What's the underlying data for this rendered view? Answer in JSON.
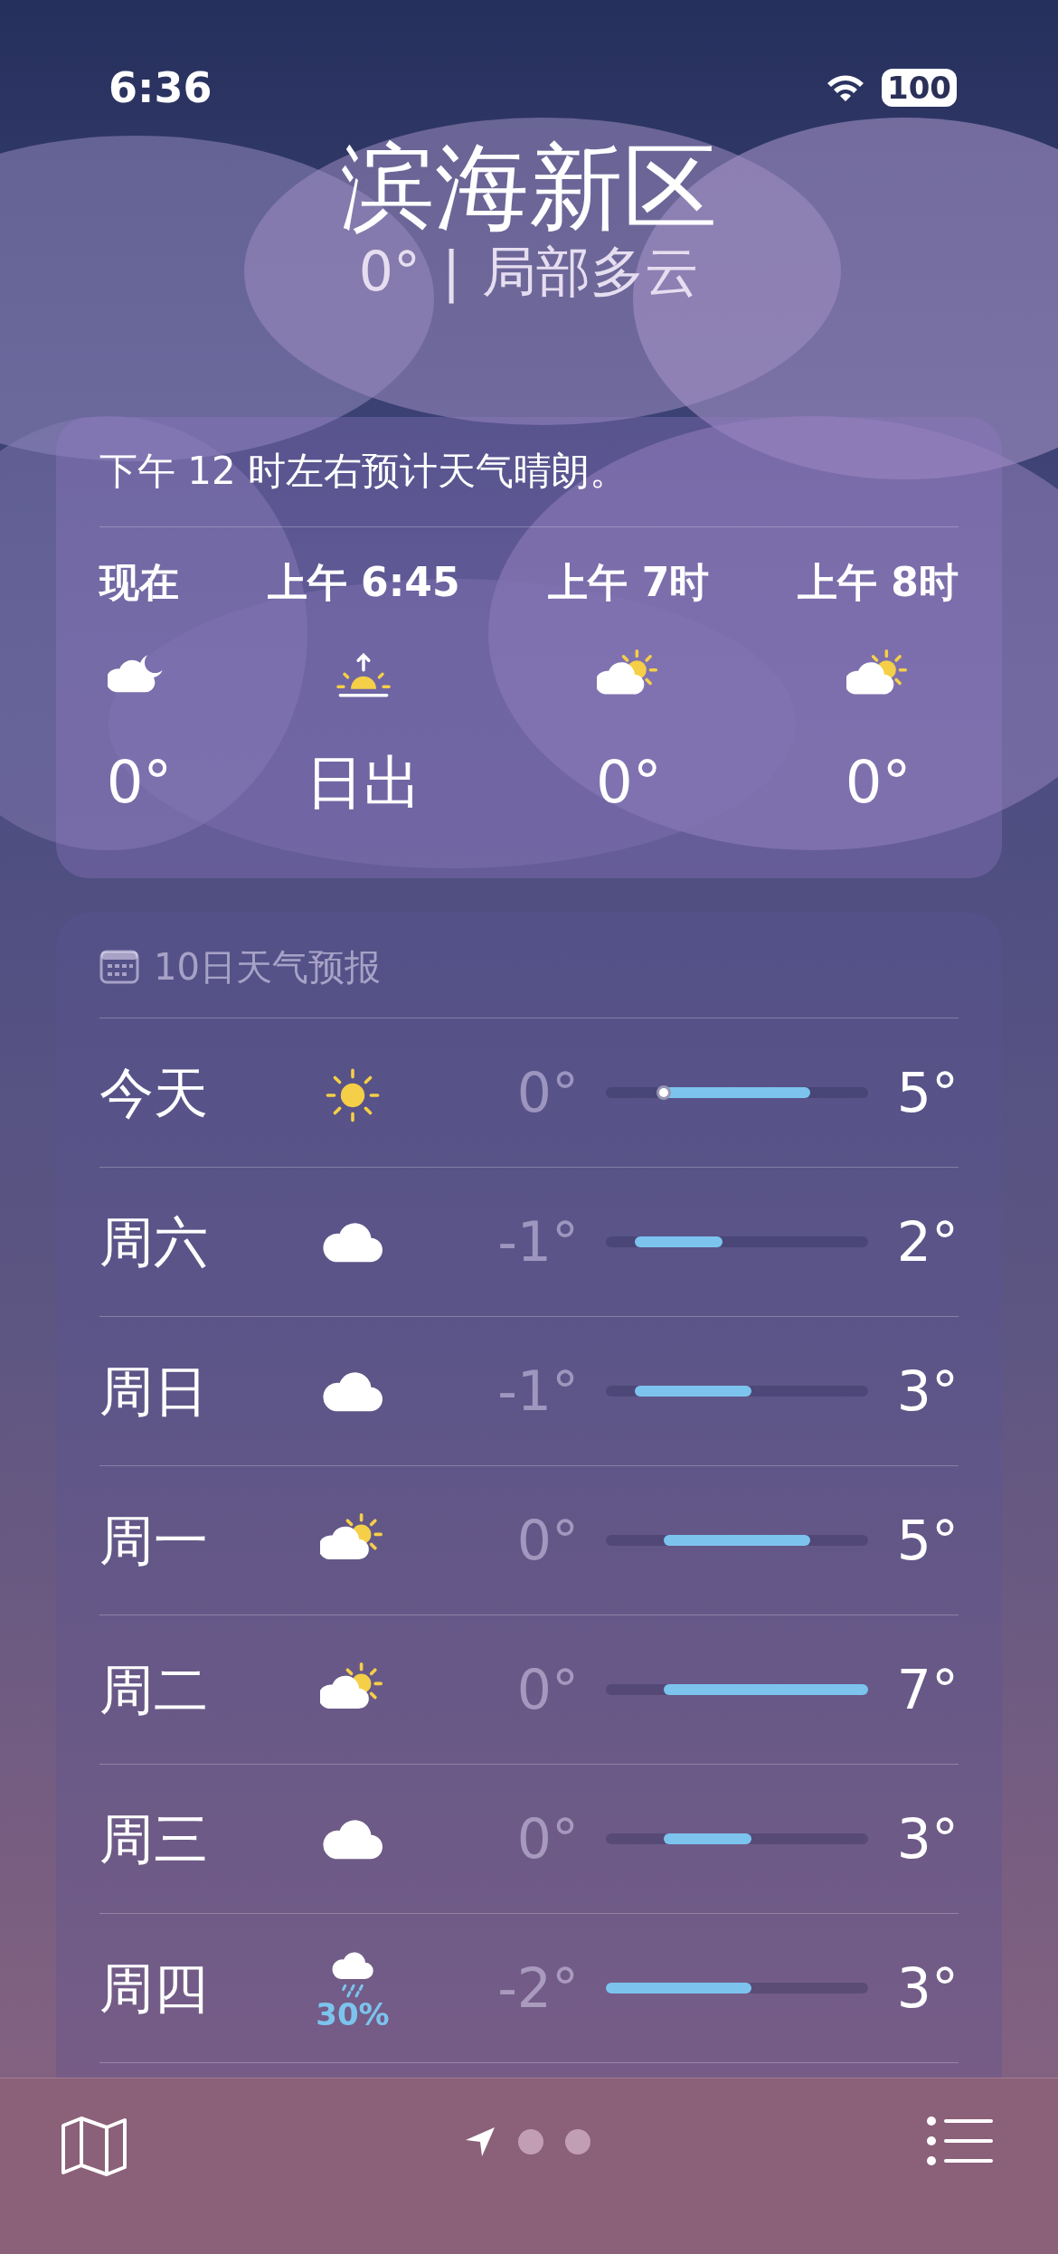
{
  "status_bar": {
    "time": "6:36",
    "battery": "100"
  },
  "location": {
    "city": "滨海新区",
    "temperature": "0°",
    "separator": "|",
    "condition": "局部多云"
  },
  "hourly": {
    "summary": "下午 12 时左右预计天气晴朗。",
    "items": [
      {
        "time": "现在",
        "kind": "cloud-moon",
        "value": "0°"
      },
      {
        "time": "上午 6:45",
        "kind": "sunrise",
        "value": "日出"
      },
      {
        "time": "上午 7时",
        "kind": "cloud-sun",
        "value": "0°"
      },
      {
        "time": "上午 8时",
        "kind": "cloud-sun",
        "value": "0°"
      }
    ]
  },
  "forecast": {
    "title": "10日天气预报",
    "days": [
      {
        "day": "今天",
        "kind": "sun",
        "low": "0°",
        "high": "5°",
        "current_marker": true
      },
      {
        "day": "周六",
        "kind": "cloud",
        "low": "-1°",
        "high": "2°",
        "current_marker": false
      },
      {
        "day": "周日",
        "kind": "cloud",
        "low": "-1°",
        "high": "3°",
        "current_marker": false
      },
      {
        "day": "周一",
        "kind": "cloud-sun",
        "low": "0°",
        "high": "5°",
        "current_marker": false
      },
      {
        "day": "周二",
        "kind": "cloud-sun",
        "low": "0°",
        "high": "7°",
        "current_marker": false
      },
      {
        "day": "周三",
        "kind": "cloud",
        "low": "0°",
        "high": "3°",
        "current_marker": false
      },
      {
        "day": "周四",
        "kind": "rain",
        "precipitation": "30%",
        "low": "-2°",
        "high": "3°",
        "current_marker": false
      }
    ]
  },
  "toolbar": {
    "pages": [
      {
        "kind": "location",
        "selected": true
      },
      {
        "kind": "dot",
        "selected": false
      },
      {
        "kind": "dot",
        "selected": false
      }
    ]
  }
}
